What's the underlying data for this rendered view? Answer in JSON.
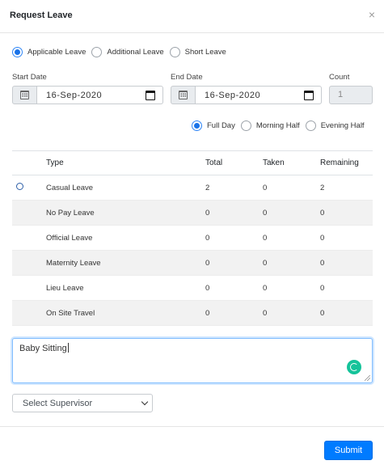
{
  "modal": {
    "title": "Request Leave",
    "close_icon": "×"
  },
  "leave_type": {
    "options": [
      {
        "label": "Applicable Leave",
        "checked": true
      },
      {
        "label": "Additional Leave",
        "checked": false
      },
      {
        "label": "Short Leave",
        "checked": false
      }
    ]
  },
  "dates": {
    "start_label": "Start Date",
    "start_value": "16-Sep-2020",
    "end_label": "End Date",
    "end_value": "16-Sep-2020",
    "count_label": "Count",
    "count_value": "1"
  },
  "day_type": {
    "options": [
      {
        "label": "Full Day",
        "checked": true
      },
      {
        "label": "Morning Half",
        "checked": false
      },
      {
        "label": "Evening Half",
        "checked": false
      }
    ]
  },
  "table": {
    "headers": [
      "",
      "Type",
      "Total",
      "Taken",
      "Remaining"
    ],
    "rows": [
      {
        "type": "Casual Leave",
        "total": "2",
        "taken": "0",
        "remaining": "2",
        "selectable": true
      },
      {
        "type": "No Pay Leave",
        "total": "0",
        "taken": "0",
        "remaining": "0",
        "selectable": false
      },
      {
        "type": "Official Leave",
        "total": "0",
        "taken": "0",
        "remaining": "0",
        "selectable": false
      },
      {
        "type": "Maternity Leave",
        "total": "0",
        "taken": "0",
        "remaining": "0",
        "selectable": false
      },
      {
        "type": "Lieu Leave",
        "total": "0",
        "taken": "0",
        "remaining": "0",
        "selectable": false
      },
      {
        "type": "On Site Travel",
        "total": "0",
        "taken": "0",
        "remaining": "0",
        "selectable": false
      }
    ]
  },
  "reason": {
    "value": "Baby Sitting"
  },
  "supervisor": {
    "selected": "Select Supervisor"
  },
  "footer": {
    "submit_label": "Submit"
  },
  "colors": {
    "primary": "#007bff",
    "radio": "#1a73e8",
    "stripe": "#f2f2f2",
    "grammarly": "#15c39a"
  },
  "icons": [
    "close-icon",
    "calendar-icon",
    "calendar-picker-icon",
    "grammarly-icon",
    "chevron-down-icon",
    "resize-handle-icon"
  ]
}
